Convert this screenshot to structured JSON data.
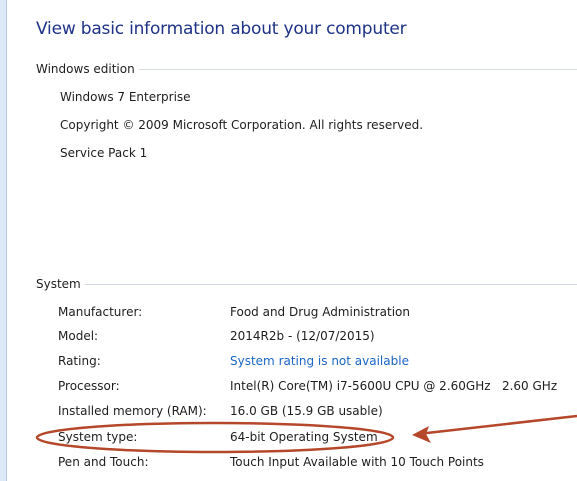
{
  "page_title": "View basic information about your computer",
  "windows_edition": {
    "header": "Windows edition",
    "edition_name": "Windows 7 Enterprise",
    "copyright": "Copyright © 2009 Microsoft Corporation.  All rights reserved.",
    "service_pack": "Service Pack 1"
  },
  "system": {
    "header": "System",
    "rows": [
      {
        "label": "Manufacturer:",
        "value": "Food and Drug Administration"
      },
      {
        "label": "Model:",
        "value": "2014R2b - (12/07/2015)"
      },
      {
        "label": "Rating:",
        "value": "System rating is not available"
      },
      {
        "label": "Processor:",
        "value": "Intel(R) Core(TM) i7-5600U CPU @ 2.60GHz   2.60 GHz"
      },
      {
        "label": "Installed memory (RAM):",
        "value": "16.0 GB (15.9 GB usable)"
      },
      {
        "label": "System type:",
        "value": "64-bit Operating System"
      },
      {
        "label": "Pen and Touch:",
        "value": "Touch Input Available with 10 Touch Points"
      }
    ]
  },
  "colors": {
    "title": "#1e3287",
    "link": "#1a66c4",
    "annotation": "#b5472a"
  }
}
